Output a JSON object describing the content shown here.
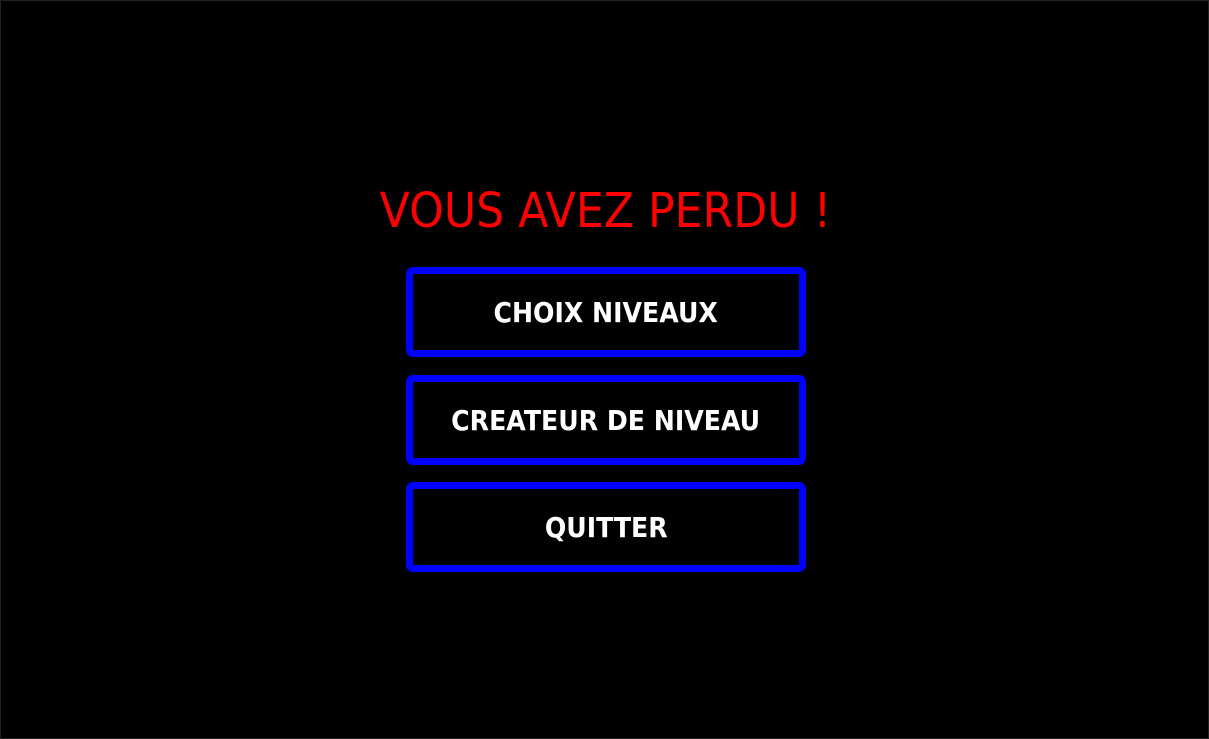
{
  "game_over": {
    "title": "VOUS AVEZ PERDU !",
    "title_color": "#ff0000"
  },
  "menu": {
    "accent_color": "#0000ff",
    "buttons": [
      {
        "label": "CHOIX NIVEAUX"
      },
      {
        "label": "CREATEUR DE NIVEAU"
      },
      {
        "label": "QUITTER"
      }
    ]
  }
}
